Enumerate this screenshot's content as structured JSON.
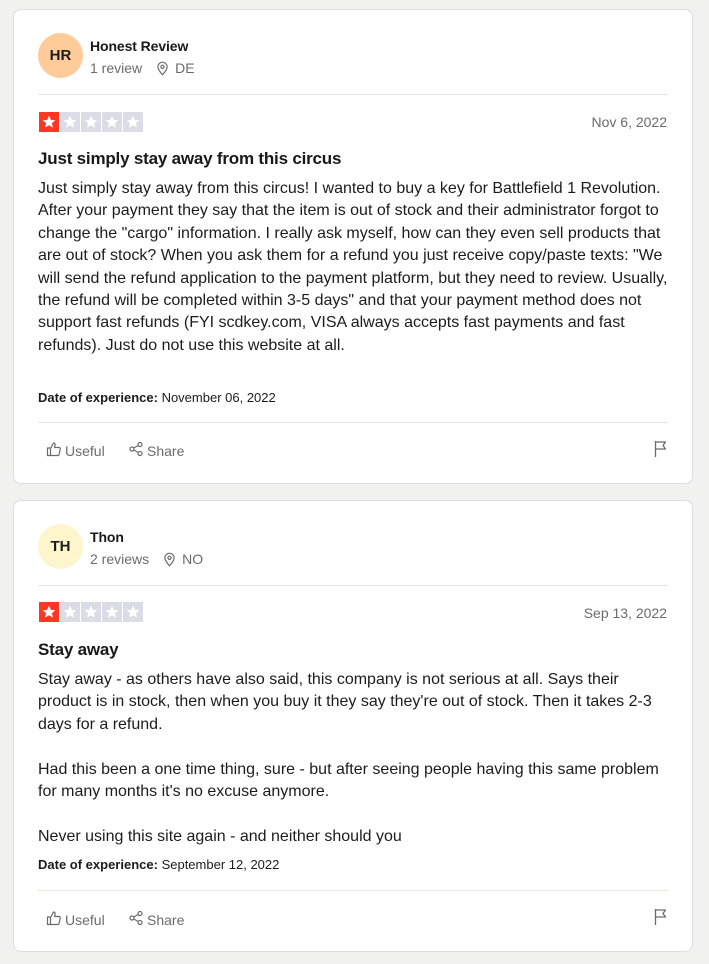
{
  "reviews": [
    {
      "avatar_initials": "HR",
      "avatar_color": "#ffcc99",
      "reviewer_name": "Honest Review",
      "review_count": "1 review",
      "country": "DE",
      "rating": 1,
      "date": "Nov 6, 2022",
      "title": "Just simply stay away from this circus",
      "body": [
        "Just simply stay away from this circus! I wanted to buy a key for Battlefield 1 Revolution. After your payment they say that the item is out of stock and their administrator forgot to change the \"cargo\" information. I really ask myself, how can they even sell products that are out of stock? When you ask them for a refund you just receive copy/paste texts: \"We will send the refund application to the payment platform, but they need to review. Usually, the refund will be completed within 3-5 days\" and that your payment method does not support fast refunds (FYI scdkey.com, VISA always accepts fast payments and fast refunds). Just do not use this website at all."
      ],
      "experience_label": "Date of experience:",
      "experience_date": "November 06, 2022",
      "useful_label": "Useful",
      "share_label": "Share"
    },
    {
      "avatar_initials": "TH",
      "avatar_color": "#fdf6cc",
      "reviewer_name": "Thon",
      "review_count": "2 reviews",
      "country": "NO",
      "rating": 1,
      "date": "Sep 13, 2022",
      "title": "Stay away",
      "body": [
        "Stay away - as others have also said, this company is not serious at all. Says their product is in stock, then when you buy it they say they're out of stock. Then it takes 2-3 days for a refund.",
        "Had this been a one time thing, sure - but after seeing people having this same problem for many months it's no excuse anymore.",
        "Never using this site again - and neither should you"
      ],
      "experience_label": "Date of experience:",
      "experience_date": "September 12, 2022",
      "useful_label": "Useful",
      "share_label": "Share"
    }
  ],
  "colors": {
    "star_filled": "#ff3722",
    "star_empty": "#dcdce6"
  }
}
